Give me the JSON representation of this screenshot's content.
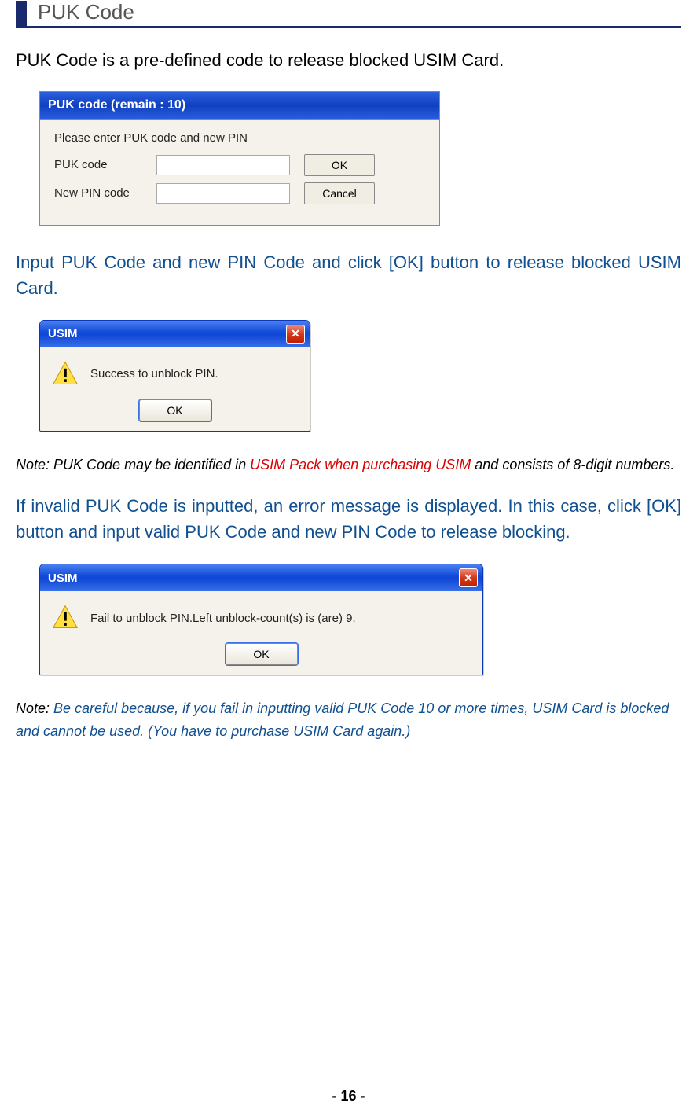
{
  "section": {
    "title": "PUK Code"
  },
  "intro": "PUK Code is a pre-defined code to release blocked USIM Card.",
  "dialog1": {
    "title": "PUK code (remain : 10)",
    "heading": "Please enter PUK code and new PIN",
    "label_puk": "PUK code",
    "label_pin": "New PIN code",
    "btn_ok": "OK",
    "btn_cancel": "Cancel"
  },
  "instruction1": "Input PUK Code and new PIN Code and click [OK] button to release blocked USIM Card.",
  "dialog2": {
    "title": "USIM",
    "message": "Success to unblock PIN.",
    "btn_ok": "OK"
  },
  "note1": {
    "prefix": "Note: PUK Code may be identified in ",
    "red": "USIM Pack when purchasing USIM",
    "suffix": " and consists of 8-digit numbers."
  },
  "instruction2": "If invalid PUK Code is inputted, an error message is displayed. In this case, click [OK] button and input valid PUK Code and new PIN Code to release blocking.",
  "dialog3": {
    "title": "USIM",
    "message": "Fail to unblock PIN.Left unblock-count(s) is (are) 9.",
    "btn_ok": "OK"
  },
  "note2": {
    "prefix": "Note: ",
    "blue": "Be careful because, if you fail in inputting valid PUK Code 10 or more times, USIM Card is blocked and cannot be used. (You have to purchase USIM Card again.)"
  },
  "page_number": "- 16 -"
}
